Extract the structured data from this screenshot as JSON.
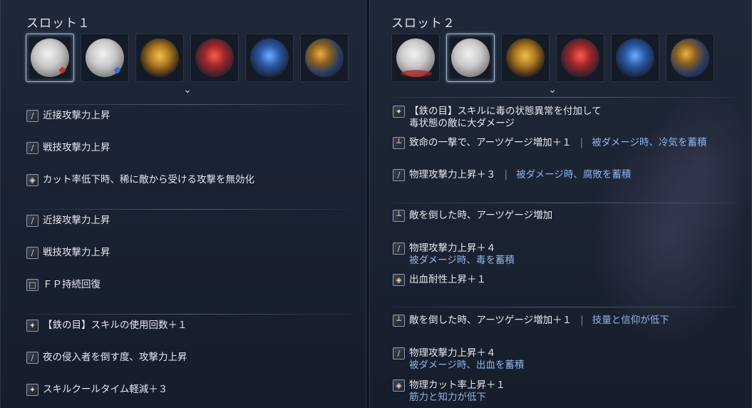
{
  "slot1": {
    "title": "スロット１",
    "gems": [
      {
        "icon": "white-relic-icon",
        "selected": true,
        "badge": "#c83030"
      },
      {
        "icon": "white-relic-icon",
        "selected": false,
        "badge": "#3070e0"
      },
      {
        "icon": "yellow-relic-icon",
        "selected": false
      },
      {
        "icon": "red-relic-icon",
        "selected": false
      },
      {
        "icon": "blue-relic-icon",
        "selected": false
      },
      {
        "icon": "yellow-blue-relic-icon",
        "selected": false
      }
    ],
    "effects": [
      {
        "icon": "sword-icon",
        "text": "近接攻撃力上昇"
      },
      {
        "icon": "sword-icon",
        "text": "戦技攻撃力上昇"
      },
      {
        "icon": "shield-icon",
        "text": "カット率低下時、稀に敵から受ける攻撃を無効化"
      },
      {
        "icon": "sword-icon",
        "text": "近接攻撃力上昇"
      },
      {
        "icon": "sword-icon",
        "text": "戦技攻撃力上昇"
      },
      {
        "icon": "fp-icon",
        "text": "ＦＰ持続回復"
      },
      {
        "icon": "skill-icon",
        "text": "【鉄の目】スキルの使用回数＋１"
      },
      {
        "icon": "sword-icon",
        "text": "夜の侵入者を倒す度、攻撃力上昇"
      },
      {
        "icon": "skill-icon",
        "text": "スキルクールタイム軽減＋３"
      }
    ]
  },
  "slot2": {
    "title": "スロット２",
    "gems": [
      {
        "icon": "white-relic-icon",
        "selected": false
      },
      {
        "icon": "white-relic-icon",
        "selected": true
      },
      {
        "icon": "yellow-relic-icon",
        "selected": false
      },
      {
        "icon": "red-relic-icon",
        "selected": false
      },
      {
        "icon": "blue-relic-icon",
        "selected": false
      },
      {
        "icon": "yellow-blue-relic-icon",
        "selected": false
      }
    ],
    "effects": [
      {
        "icon": "skill-icon",
        "text": "【鉄の目】スキルに毒の状態異常を付加して",
        "line2": "毒状態の敵に大ダメージ"
      },
      {
        "icon": "arts-icon",
        "text": "致命の一撃で、アーツゲージ増加＋１",
        "sub": "被ダメージ時、冷気を蓄積"
      },
      {
        "icon": "sword-icon",
        "text": "物理攻撃力上昇＋３",
        "sub": "被ダメージ時、腐敗を蓄積"
      },
      {
        "icon": "arts-icon",
        "text": "敵を倒した時、アーツゲージ増加"
      },
      {
        "icon": "sword-icon",
        "text": "物理攻撃力上昇＋４",
        "sub2": "被ダメージ時、毒を蓄積"
      },
      {
        "icon": "shield-icon",
        "text": "出血耐性上昇＋１"
      },
      {
        "icon": "arts-icon",
        "text": "敵を倒した時、アーツゲージ増加＋１",
        "sub": "技量と信仰が低下"
      },
      {
        "icon": "sword-icon",
        "text": "物理攻撃力上昇＋４",
        "sub2": "被ダメージ時、出血を蓄積"
      },
      {
        "icon": "shield-icon",
        "text": "物理カット率上昇＋１",
        "sub2": "筋力と知力が低下"
      }
    ]
  },
  "colors": {
    "accent_blue_text": "#8fb4e8",
    "main_text": "#e6e8ec",
    "selected_border": "#9fb4cf"
  }
}
